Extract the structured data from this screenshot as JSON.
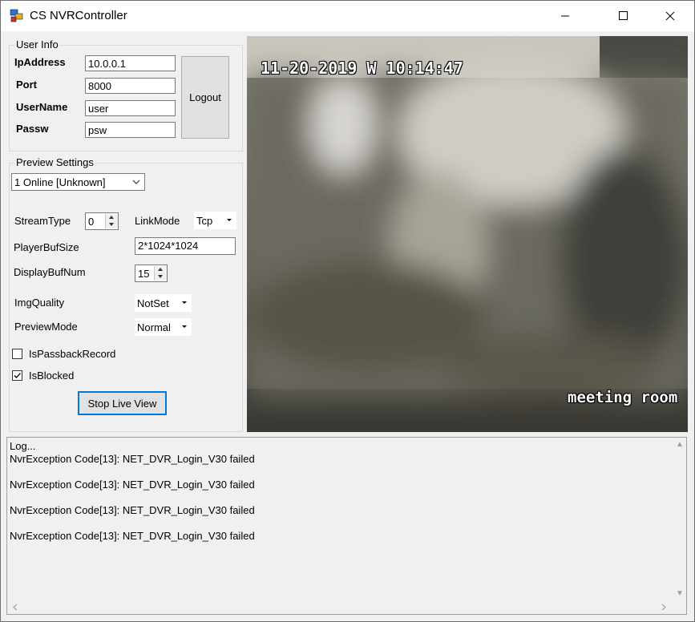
{
  "window": {
    "title": "CS NVRController",
    "controls": [
      "minimize-icon",
      "maximize-icon",
      "close-icon"
    ]
  },
  "user_info": {
    "legend": "User Info",
    "ip_label": "IpAddress",
    "ip_value": "10.0.0.1",
    "port_label": "Port",
    "port_value": "8000",
    "username_label": "UserName",
    "username_value": "user",
    "password_label": "Passw",
    "password_value": "psw",
    "logout_label": "Logout"
  },
  "preview_settings": {
    "legend": "Preview Settings",
    "channel_selected": "1 Online [Unknown]",
    "stream_type_label": "StreamType",
    "stream_type_value": "0",
    "link_mode_label": "LinkMode",
    "link_mode_value": "Tcp",
    "player_buf_label": "PlayerBufSize",
    "player_buf_value": "2*1024*1024",
    "display_buf_label": "DisplayBufNum",
    "display_buf_value": "15",
    "img_quality_label": "ImgQuality",
    "img_quality_value": "NotSet",
    "preview_mode_label": "PreviewMode",
    "preview_mode_value": "Normal",
    "passback_label": "IsPassbackRecord",
    "passback_checked": false,
    "blocked_label": "IsBlocked",
    "blocked_checked": true,
    "stop_button_label": "Stop Live View"
  },
  "video": {
    "timestamp": "11-20-2019 W  10:14:47",
    "camera_name": "meeting room"
  },
  "log": {
    "lines": [
      "Log...",
      "NvrException Code[13]: NET_DVR_Login_V30 failed",
      "",
      "NvrException Code[13]: NET_DVR_Login_V30 failed",
      "",
      "NvrException Code[13]: NET_DVR_Login_V30 failed",
      "",
      "NvrException Code[13]: NET_DVR_Login_V30 failed"
    ]
  },
  "colors": {
    "accent_border": "#0078d7",
    "window_bg": "#f0f0f0"
  }
}
